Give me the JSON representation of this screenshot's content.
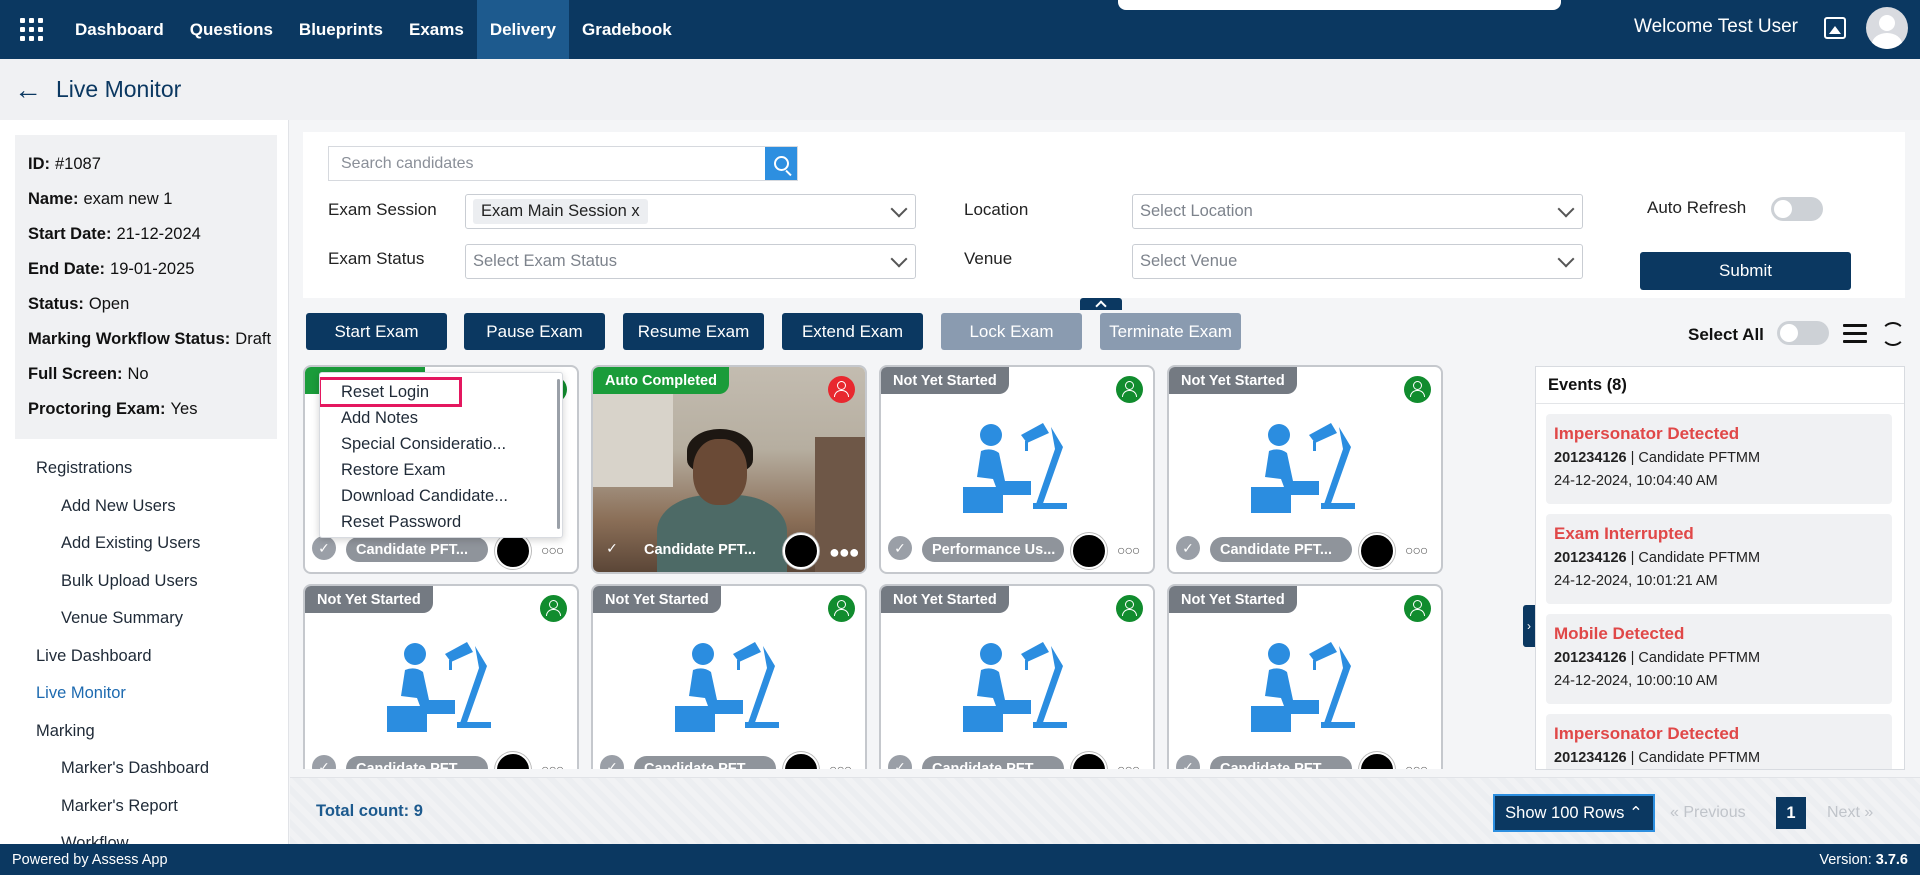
{
  "nav": {
    "items": [
      "Dashboard",
      "Questions",
      "Blueprints",
      "Exams",
      "Delivery",
      "Gradebook"
    ],
    "active": "Delivery",
    "welcome": "Welcome Test User"
  },
  "page": {
    "title": "Live Monitor"
  },
  "exam_info": {
    "rows": [
      {
        "label": "ID:",
        "value": "#1087"
      },
      {
        "label": "Name:",
        "value": "exam new 1"
      },
      {
        "label": "Start Date:",
        "value": "21-12-2024"
      },
      {
        "label": "End Date:",
        "value": "19-01-2025"
      },
      {
        "label": "Status:",
        "value": "Open"
      },
      {
        "label": "Marking Workflow Status:",
        "value": "Draft"
      },
      {
        "label": "Full Screen:",
        "value": "No"
      },
      {
        "label": "Proctoring Exam:",
        "value": "Yes"
      }
    ]
  },
  "sidebar": {
    "items": [
      {
        "label": "Registrations",
        "sub": false
      },
      {
        "label": "Add New Users",
        "sub": true
      },
      {
        "label": "Add Existing Users",
        "sub": true
      },
      {
        "label": "Bulk Upload Users",
        "sub": true
      },
      {
        "label": "Venue Summary",
        "sub": true
      },
      {
        "label": "Live Dashboard",
        "sub": false
      },
      {
        "label": "Live Monitor",
        "sub": false,
        "active": true
      },
      {
        "label": "Marking",
        "sub": false
      },
      {
        "label": "Marker's Dashboard",
        "sub": true
      },
      {
        "label": "Marker's Report",
        "sub": true
      },
      {
        "label": "Workflow",
        "sub": true
      }
    ]
  },
  "filters": {
    "search_placeholder": "Search candidates",
    "exam_session_label": "Exam Session",
    "exam_session_chip": "Exam Main Session x",
    "exam_status_label": "Exam Status",
    "exam_status_placeholder": "Select Exam Status",
    "location_label": "Location",
    "location_placeholder": "Select Location",
    "venue_label": "Venue",
    "venue_placeholder": "Select Venue",
    "auto_refresh_label": "Auto Refresh",
    "submit_label": "Submit"
  },
  "actions": {
    "start": "Start Exam",
    "pause": "Pause Exam",
    "resume": "Resume Exam",
    "extend": "Extend Exam",
    "lock": "Lock Exam",
    "terminate": "Terminate Exam",
    "select_all": "Select All"
  },
  "tiles": [
    {
      "badge": "",
      "candidate": "Candidate PFT...",
      "status_color": "#118c2e",
      "video": false
    },
    {
      "badge": "Auto Completed",
      "candidate": "Candidate PFT...",
      "status_color": "#e8282f",
      "video": true
    },
    {
      "badge": "Not Yet Started",
      "candidate": "Performance Us...",
      "status_color": "#118c2e",
      "video": false
    },
    {
      "badge": "Not Yet Started",
      "candidate": "Candidate PFT...",
      "status_color": "#118c2e",
      "video": false
    },
    {
      "badge": "Not Yet Started",
      "candidate": "Candidate PFT...",
      "status_color": "#118c2e",
      "video": false
    },
    {
      "badge": "Not Yet Started",
      "candidate": "Candidate PFT...",
      "status_color": "#118c2e",
      "video": false
    },
    {
      "badge": "Not Yet Started",
      "candidate": "Candidate PFT...",
      "status_color": "#118c2e",
      "video": false
    },
    {
      "badge": "Not Yet Started",
      "candidate": "Candidate PFT...",
      "status_color": "#118c2e",
      "video": false
    }
  ],
  "context_menu": {
    "items": [
      "Reset Login",
      "Add Notes",
      "Special Consideratio...",
      "Restore Exam",
      "Download Candidate...",
      "Reset Password"
    ]
  },
  "events": {
    "header": "Events (8)",
    "list": [
      {
        "title": "Impersonator Detected",
        "id": "201234126",
        "candidate": " | Candidate PFTMM",
        "time": "24-12-2024, 10:04:40 AM"
      },
      {
        "title": "Exam Interrupted",
        "id": "201234126",
        "candidate": " | Candidate PFTMM",
        "time": "24-12-2024, 10:01:21 AM"
      },
      {
        "title": "Mobile Detected",
        "id": "201234126",
        "candidate": " | Candidate PFTMM",
        "time": "24-12-2024, 10:00:10 AM"
      },
      {
        "title": "Impersonator Detected",
        "id": "201234126",
        "candidate": " | Candidate PFTMM",
        "time": ""
      }
    ]
  },
  "bottom": {
    "total": "Total count: 9",
    "rows": "Show 100 Rows",
    "prev": "Previous",
    "page": "1",
    "next": "Next"
  },
  "footer": {
    "powered": "Powered by Assess App",
    "version_label": "Version: ",
    "version": "3.7.6"
  },
  "colors": {
    "brand": "#0b3861",
    "accent": "#2d8fe0",
    "highlight": "#e4175f",
    "event_alert": "#e04848"
  },
  "icons": {
    "apps": "apps-grid-icon",
    "back": "arrow-left-icon",
    "search": "search-icon",
    "image": "image-icon",
    "user": "user-icon",
    "list": "list-view-icon",
    "refresh": "refresh-icon",
    "chevron": "chevron-down-icon"
  }
}
